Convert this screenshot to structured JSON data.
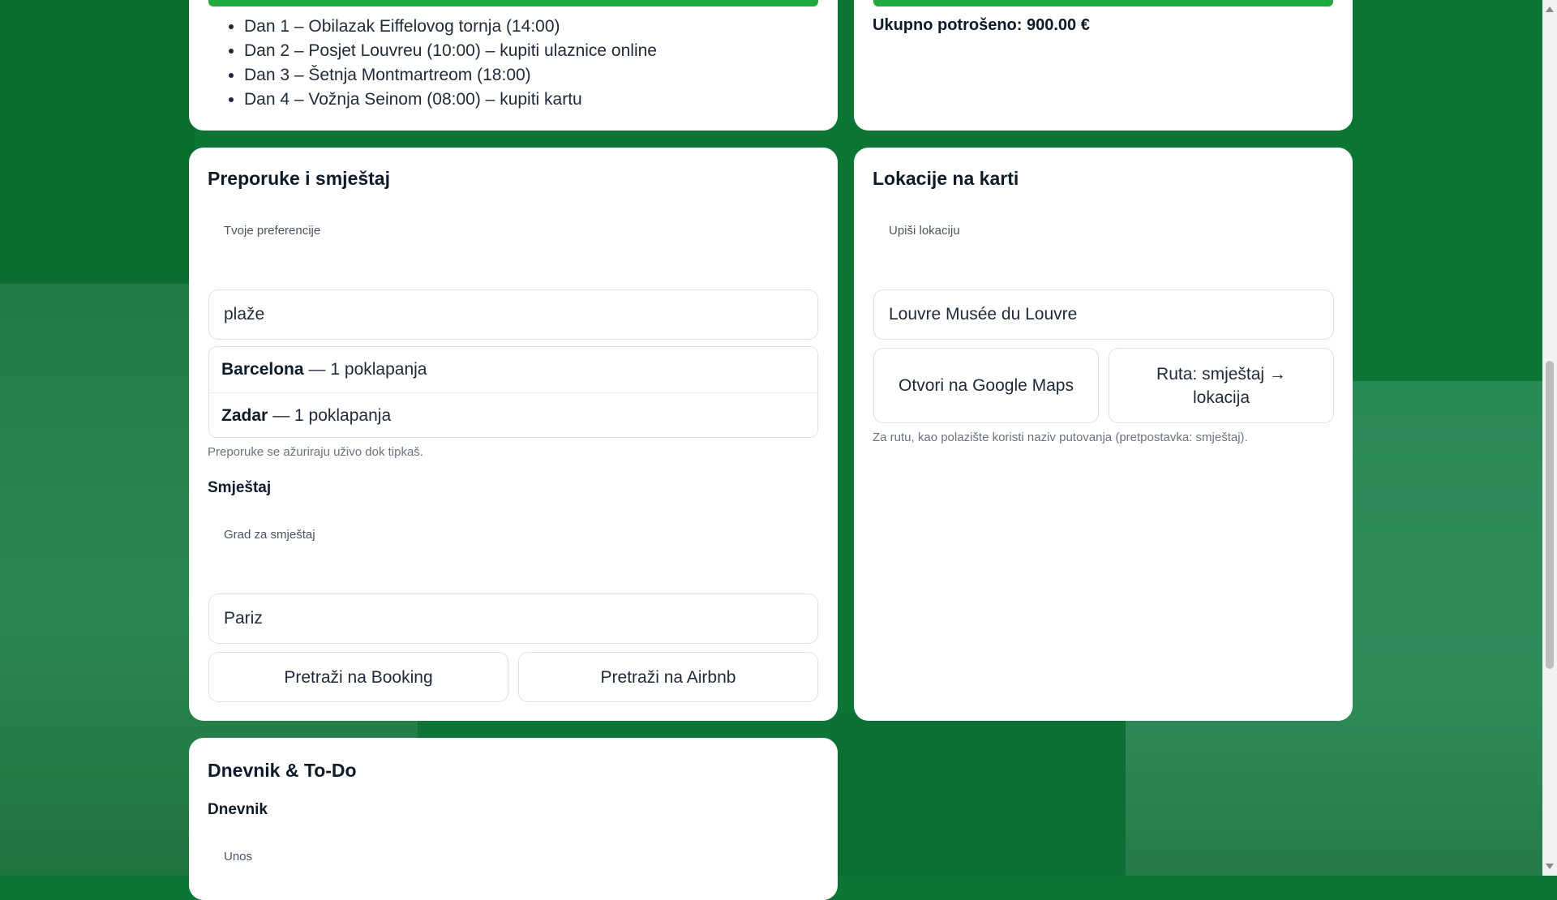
{
  "plan": {
    "items": [
      "Dan 1 – Obilazak Eiffelovog tornja (14:00)",
      "Dan 2 – Posjet Louvreu (10:00) – kupiti ulaznice online",
      "Dan 3 – Šetnja Montmartreom (18:00)",
      "Dan 4 – Vožnja Seinom (08:00) – kupiti kartu"
    ]
  },
  "budget": {
    "total_label": "Ukupno potrošeno: 900.00 €"
  },
  "recommendations": {
    "title": "Preporuke i smještaj",
    "pref_label": "Tvoje preferencije",
    "pref_value": "plaže",
    "results": [
      {
        "city": "Barcelona",
        "suffix": "— 1 poklapanja"
      },
      {
        "city": "Zadar",
        "suffix": "— 1 poklapanja"
      }
    ],
    "hint": "Preporuke se ažuriraju uživo dok tipkaš.",
    "accommodation_title": "Smještaj",
    "city_label": "Grad za smještaj",
    "city_value": "Pariz",
    "booking_button": "Pretraži na Booking",
    "airbnb_button": "Pretraži na Airbnb"
  },
  "map": {
    "title": "Lokacije na karti",
    "location_label": "Upiši lokaciju",
    "location_value": "Louvre Musée du Louvre",
    "google_maps_button": "Otvori na Google Maps",
    "route_button": "Ruta: smještaj → lokacija",
    "hint": "Za rutu, kao polazište koristi naziv putovanja (pretpostavka: smještaj)."
  },
  "journal": {
    "title": "Dnevnik & To-Do",
    "diary_title": "Dnevnik",
    "entry_label": "Unos"
  },
  "colors": {
    "accent": "#1faa3f",
    "background": "#0d7636"
  }
}
